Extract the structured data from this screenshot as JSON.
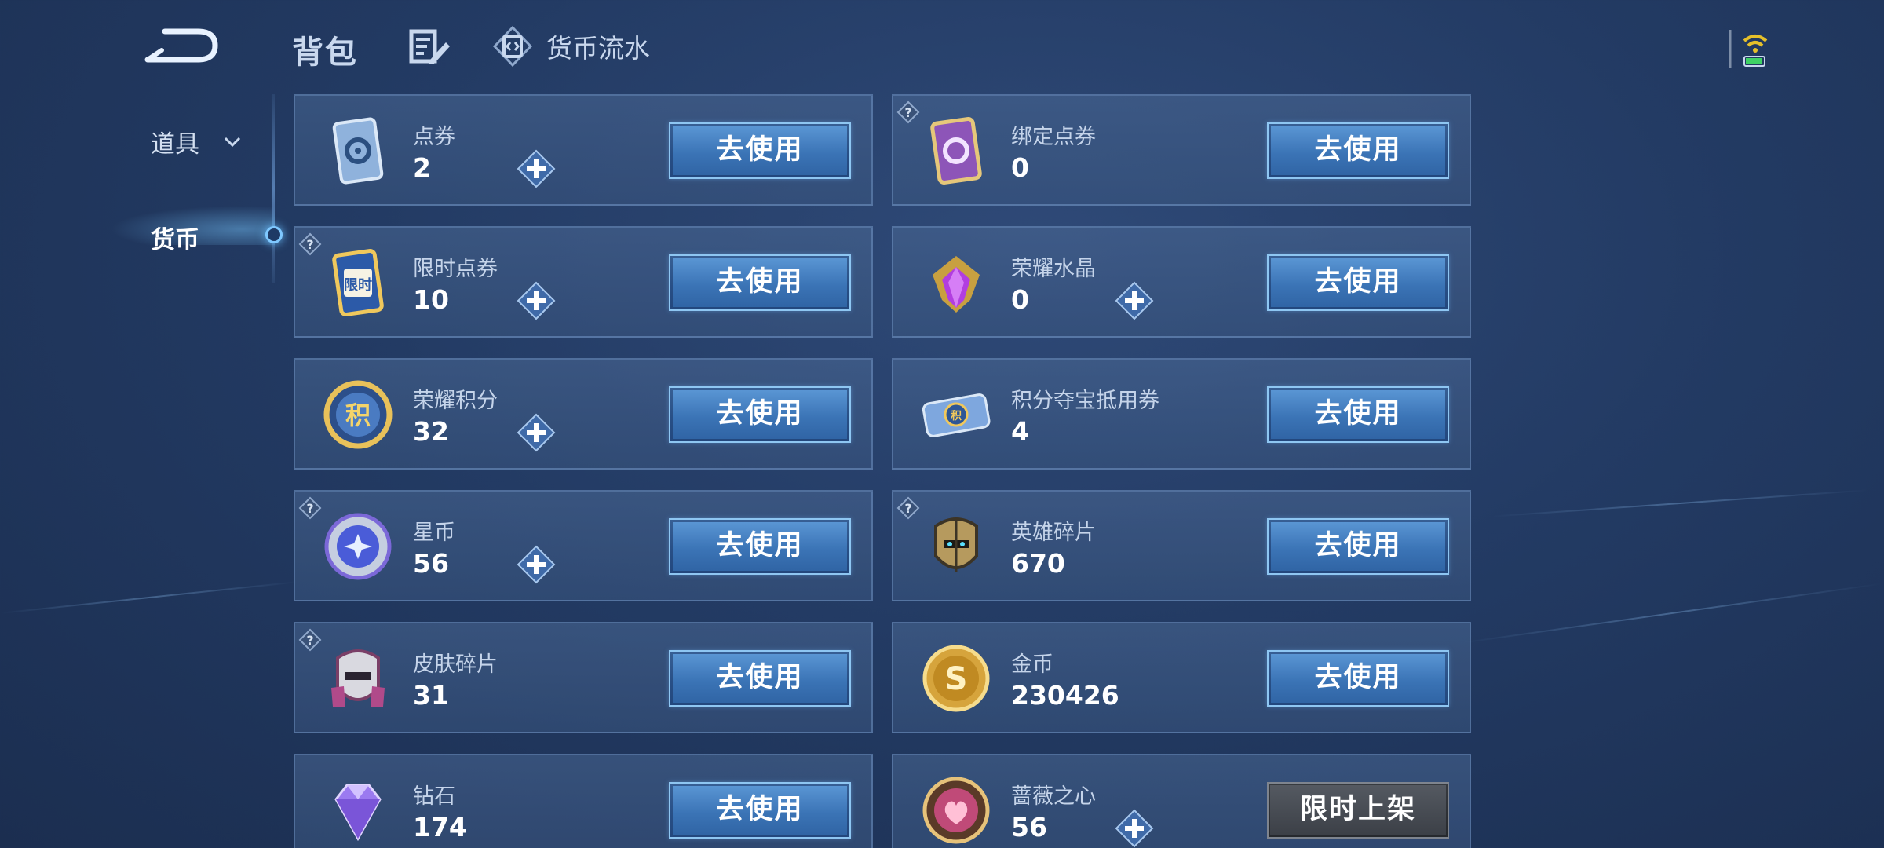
{
  "header": {
    "title": "背包",
    "ledger_label": "货币流水"
  },
  "sidebar": {
    "items": [
      {
        "label": "道具",
        "active": false
      },
      {
        "label": "货币",
        "active": true
      }
    ]
  },
  "cards": [
    {
      "name": "点券",
      "value": "2",
      "button": "去使用",
      "icon": "ticket-card-icon",
      "has_plus": true,
      "has_help": false
    },
    {
      "name": "绑定点券",
      "value": "0",
      "button": "去使用",
      "icon": "bound-ticket-icon",
      "has_plus": false,
      "has_help": true
    },
    {
      "name": "限时点券",
      "value": "10",
      "button": "去使用",
      "icon": "limited-ticket-icon",
      "has_plus": true,
      "has_help": true
    },
    {
      "name": "荣耀水晶",
      "value": "0",
      "button": "去使用",
      "icon": "glory-crystal-icon",
      "has_plus": true,
      "has_help": false
    },
    {
      "name": "荣耀积分",
      "value": "32",
      "button": "去使用",
      "icon": "glory-points-icon",
      "has_plus": true,
      "has_help": false
    },
    {
      "name": "积分夺宝抵用券",
      "value": "4",
      "button": "去使用",
      "icon": "points-voucher-icon",
      "has_plus": false,
      "has_help": false
    },
    {
      "name": "星币",
      "value": "56",
      "button": "去使用",
      "icon": "star-coin-icon",
      "has_plus": true,
      "has_help": true
    },
    {
      "name": "英雄碎片",
      "value": "670",
      "button": "去使用",
      "icon": "hero-fragment-icon",
      "has_plus": false,
      "has_help": true
    },
    {
      "name": "皮肤碎片",
      "value": "31",
      "button": "去使用",
      "icon": "skin-fragment-icon",
      "has_plus": false,
      "has_help": true
    },
    {
      "name": "金币",
      "value": "230426",
      "button": "去使用",
      "icon": "gold-coin-icon",
      "has_plus": false,
      "has_help": false
    },
    {
      "name": "钻石",
      "value": "174",
      "button": "去使用",
      "icon": "diamond-icon",
      "has_plus": false,
      "has_help": false
    },
    {
      "name": "蔷薇之心",
      "value": "56",
      "button": "限时上架",
      "icon": "rose-heart-icon",
      "has_plus": true,
      "has_help": false
    }
  ],
  "colors": {
    "accent_button": "#3b74b6",
    "background": "#233b64",
    "disabled_button": "#4a4e56"
  }
}
